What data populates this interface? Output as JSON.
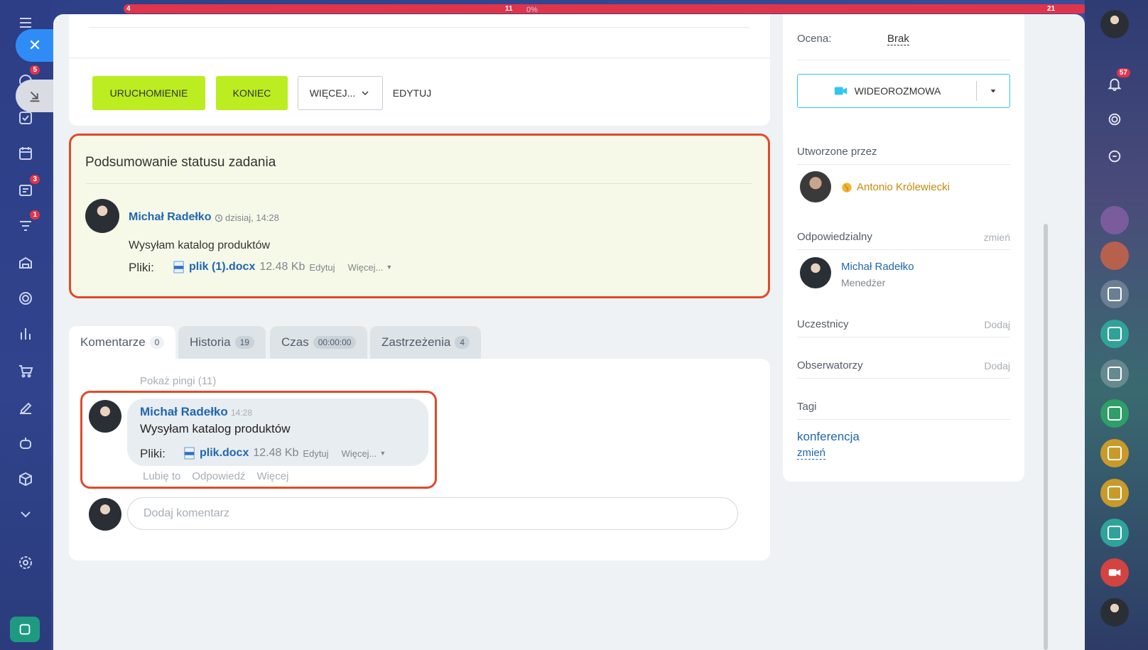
{
  "task_actions": {
    "start_label": "URUCHOMIENIE",
    "finish_label": "KONIEC",
    "more_label": "WIĘCEJ...",
    "edit_label": "EDYTUJ"
  },
  "summary": {
    "title": "Podsumowanie statusu zadania",
    "author": "Michał Radełko",
    "time": "dzisiaj, 14:28",
    "text": "Wysyłam katalog produktów",
    "files_label": "Pliki:",
    "file_name": "plik (1).docx",
    "file_size": "12.48 Kb",
    "file_edit": "Edytuj",
    "file_more": "Więcej..."
  },
  "tabs": [
    {
      "label": "Komentarze",
      "count": "0"
    },
    {
      "label": "Historia",
      "count": "19"
    },
    {
      "label": "Czas",
      "count": "00:00:00"
    },
    {
      "label": "Zastrzeżenia",
      "count": "4"
    }
  ],
  "comments": {
    "show_pings": "Pokaż pingi (11)",
    "author": "Michał Radełko",
    "time": "14:28",
    "text": "Wysyłam katalog produktów",
    "files_label": "Pliki:",
    "file_name": "plik.docx",
    "file_size": "12.48 Kb",
    "file_edit": "Edytuj",
    "file_more": "Więcej...",
    "like": "Lubię to",
    "reply": "Odpowiedź",
    "more": "Więcej",
    "input_placeholder": "Dodaj komentarz"
  },
  "sidebar_right": {
    "rating_label": "Ocena:",
    "rating_value": "Brak",
    "video_label": "WIDEOROZMOWA",
    "created_by_label": "Utworzone przez",
    "creator": "Antonio Królewiecki",
    "responsible_label": "Odpowiedzialny",
    "change": "zmień",
    "responsible_name": "Michał Radełko",
    "responsible_role": "Menedżer",
    "participants_label": "Uczestnicy",
    "observers_label": "Obserwatorzy",
    "add": "Dodaj",
    "tags_label": "Tagi",
    "tag": "konferencja",
    "tag_change": "zmień"
  },
  "badges": {
    "left_counters": [
      "5",
      "3",
      "1"
    ],
    "notifications": "57",
    "top_counters": [
      "4",
      "11",
      "0%",
      "21"
    ]
  },
  "colors": {
    "accent_green": "#bbed21",
    "highlight_red": "#e04a2a",
    "link_blue": "#2067b0",
    "close_blue": "#2f8cf6"
  }
}
